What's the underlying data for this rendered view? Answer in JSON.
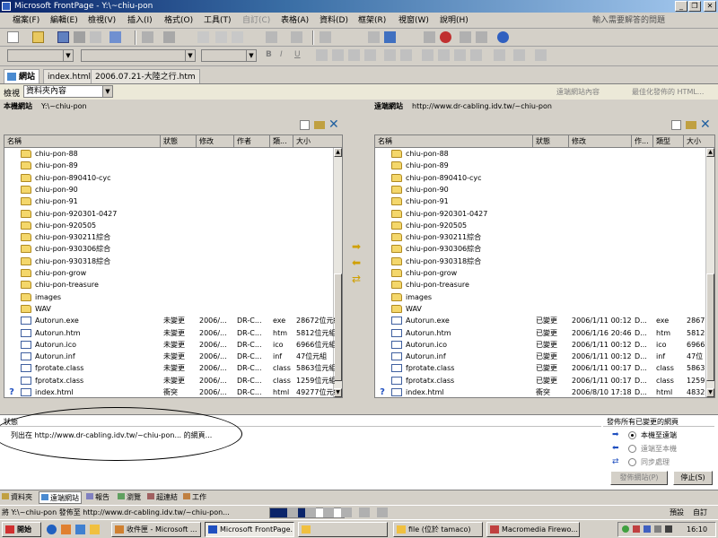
{
  "window": {
    "title": "Microsoft FrontPage - Y:\\~chiu-pon",
    "min": "_",
    "max": "❐",
    "close": "✕"
  },
  "menu": {
    "items": [
      "檔案(F)",
      "編輯(E)",
      "檢視(V)",
      "插入(I)",
      "格式(O)",
      "工具(T)",
      "自訂(C)",
      "表格(A)",
      "資料(D)",
      "框架(R)",
      "視窗(W)",
      "說明(H)"
    ],
    "ask": "輸入需要解答的問題"
  },
  "tabs": [
    {
      "label": "網站",
      "active": true
    },
    {
      "label": "index.html",
      "active": false
    },
    {
      "label": "2006.07.21-大陸之行.htm",
      "active": false
    }
  ],
  "viewbar": {
    "label": "檢視",
    "value": "資料夾內容",
    "remote_link": "遠端網站內容",
    "optimize_link": "最佳化發佈的 HTML..."
  },
  "local": {
    "title": "本機網站",
    "path": "Y:\\~chiu-pon",
    "columns": [
      "名稱",
      "狀態",
      "修改",
      "作者",
      "類...",
      "大小"
    ],
    "folders": [
      "chiu-pon-88",
      "chiu-pon-89",
      "chiu-pon-890410-cyc",
      "chiu-pon-90",
      "chiu-pon-91",
      "chiu-pon-920301-0427",
      "chiu-pon-920505",
      "chiu-pon-930211綜合",
      "chiu-pon-930306綜合",
      "chiu-pon-930318綜合",
      "chiu-pon-grow",
      "chiu-pon-treasure",
      "images",
      "WAV"
    ],
    "files": [
      {
        "name": "Autorun.exe",
        "status": "未變更",
        "modified": "2006/...",
        "author": "DR-C...",
        "type": "exe",
        "size": "28672位元組"
      },
      {
        "name": "Autorun.htm",
        "status": "未變更",
        "modified": "2006/...",
        "author": "DR-C...",
        "type": "htm",
        "size": "5812位元組"
      },
      {
        "name": "Autorun.ico",
        "status": "未變更",
        "modified": "2006/...",
        "author": "DR-C...",
        "type": "ico",
        "size": "6966位元組"
      },
      {
        "name": "Autorun.inf",
        "status": "未變更",
        "modified": "2006/...",
        "author": "DR-C...",
        "type": "inf",
        "size": "47位元組"
      },
      {
        "name": "fprotate.class",
        "status": "未變更",
        "modified": "2006/...",
        "author": "DR-C...",
        "type": "class",
        "size": "5863位元組"
      },
      {
        "name": "fprotatx.class",
        "status": "未變更",
        "modified": "2006/...",
        "author": "DR-C...",
        "type": "class",
        "size": "1259位元組"
      },
      {
        "name": "index.html",
        "status": "衝突",
        "modified": "2006/...",
        "author": "DR-C...",
        "type": "html",
        "size": "49277位元組"
      }
    ]
  },
  "remote": {
    "title": "遠端網站",
    "path": "http://www.dr-cabling.idv.tw/~chiu-pon",
    "columns": [
      "名稱",
      "狀態",
      "修改",
      "作...",
      "類型",
      "大小"
    ],
    "folders": [
      "chiu-pon-88",
      "chiu-pon-89",
      "chiu-pon-890410-cyc",
      "chiu-pon-90",
      "chiu-pon-91",
      "chiu-pon-920301-0427",
      "chiu-pon-920505",
      "chiu-pon-930211綜合",
      "chiu-pon-930306綜合",
      "chiu-pon-930318綜合",
      "chiu-pon-grow",
      "chiu-pon-treasure",
      "images",
      "WAV"
    ],
    "files": [
      {
        "name": "Autorun.exe",
        "status": "已變更",
        "modified": "2006/1/11 00:12",
        "author": "D...",
        "type": "exe",
        "size": "2867"
      },
      {
        "name": "Autorun.htm",
        "status": "已變更",
        "modified": "2006/1/16 20:46",
        "author": "D...",
        "type": "htm",
        "size": "5812"
      },
      {
        "name": "Autorun.ico",
        "status": "已變更",
        "modified": "2006/1/11 00:12",
        "author": "D...",
        "type": "ico",
        "size": "6966"
      },
      {
        "name": "Autorun.inf",
        "status": "已變更",
        "modified": "2006/1/11 00:12",
        "author": "D...",
        "type": "inf",
        "size": "47位"
      },
      {
        "name": "fprotate.class",
        "status": "已變更",
        "modified": "2006/1/11 00:17",
        "author": "D...",
        "type": "class",
        "size": "5863"
      },
      {
        "name": "fprotatx.class",
        "status": "已變更",
        "modified": "2006/1/11 00:17",
        "author": "D...",
        "type": "class",
        "size": "1259"
      },
      {
        "name": "index.html",
        "status": "衝突",
        "modified": "2006/8/10 17:18",
        "author": "D...",
        "type": "html",
        "size": "4832"
      }
    ]
  },
  "status": {
    "label": "狀態",
    "message": "列出在 http://www.dr-cabling.idv.tw/~chiu-pon... 的網頁...",
    "publish_title": "發佈所有已變更的網頁",
    "options": [
      "本機至遠端",
      "遠端至本機",
      "同步處理"
    ],
    "publish_button": "發佈網站(P)",
    "stop_button": "停止(S)"
  },
  "views": [
    "資料夾",
    "遠端網站",
    "報告",
    "瀏覽",
    "超連結",
    "工作"
  ],
  "statusbar": {
    "text": "將 Y:\\~chiu-pon 發佈至 http://www.dr-cabling.idv.tw/~chiu-pon...",
    "mode": "預設",
    "view": "自訂"
  },
  "taskbar": {
    "start": "開始",
    "tasks": [
      "收件匣 - Microsoft ...",
      "Microsoft FrontPage...",
      "",
      "file (位於 tamaco)",
      "Macromedia Firewo..."
    ],
    "clock": "16:10"
  },
  "colors": {
    "title_start": "#0a246a",
    "folder": "#f4d76b",
    "highlight_blue": "#2050c0"
  }
}
